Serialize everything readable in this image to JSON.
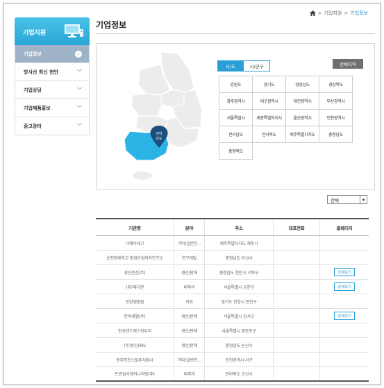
{
  "breadcrumb": {
    "level1": "기업지원",
    "current": "기업정보",
    "sep": ">"
  },
  "sidebar": {
    "title": "기업지원",
    "items": [
      {
        "label": "기업정보"
      },
      {
        "label": "방사선 최신 현안"
      },
      {
        "label": "기업상담"
      },
      {
        "label": "기업제품홍보"
      },
      {
        "label": "중고장터"
      }
    ]
  },
  "page": {
    "title": "기업정보"
  },
  "map": {
    "highlight_color": "#2bb3e6",
    "base_color": "#ececec",
    "marker_label_1": "전라",
    "marker_label_2": "남도",
    "tabs": [
      "시/도",
      "시/군구"
    ],
    "all_region_button": "전체지역",
    "regions": [
      "강원도",
      "경기도",
      "경상남도",
      "경상북도",
      "광주광역시",
      "대구광역시",
      "대전광역시",
      "부산광역시",
      "서울특별시",
      "세종특별자치시",
      "울산광역시",
      "인천광역시",
      "전라남도",
      "전라북도",
      "제주특별자치도",
      "충청남도",
      "충청북도"
    ]
  },
  "filter": {
    "value": "전체"
  },
  "table": {
    "headers": [
      "기관명",
      "분야",
      "주소",
      "대표전화",
      "홈페이지"
    ],
    "detail_label": "상세보기",
    "rows": [
      {
        "name": "디에이테크",
        "field": "기타(일반인...",
        "addr": "제주특별자치도  제주시",
        "phone": "",
        "home": false
      },
      {
        "name": "순천향대학교 환경산업의학연구소",
        "field": "연구개발",
        "addr": "충청남도  아산시",
        "phone": "",
        "home": false
      },
      {
        "name": "경신전선(주)",
        "field": "생산/판매",
        "addr": "충청남도  천안시 서북구",
        "phone": "",
        "home": true
      },
      {
        "name": "(주)메자젠",
        "field": "비파괴",
        "addr": "서울특별시  금천구",
        "phone": "",
        "home": true
      },
      {
        "name": "안양샘병원",
        "field": "의료",
        "addr": "경기도  안양시 만안구",
        "phone": "",
        "home": false
      },
      {
        "name": "한독레벨(주)",
        "field": "생산/판매",
        "addr": "서울특별시  강서구",
        "phone": "",
        "home": true
      },
      {
        "name": "한국엔드레스하우저",
        "field": "생산/판매",
        "addr": "서울특별시  영등포구",
        "phone": "",
        "home": false
      },
      {
        "name": "(주)동신FNS",
        "field": "생산/판매",
        "addr": "충청남도  논산시",
        "phone": "",
        "home": false
      },
      {
        "name": "동부인천스틸주식회사",
        "field": "기타(일반인...",
        "addr": "인천광역시  서구",
        "phone": "",
        "home": false
      },
      {
        "name": "트윈검사엔지니어링(주)",
        "field": "비파괴",
        "addr": "전라북도  군산시",
        "phone": "",
        "home": false
      }
    ]
  }
}
